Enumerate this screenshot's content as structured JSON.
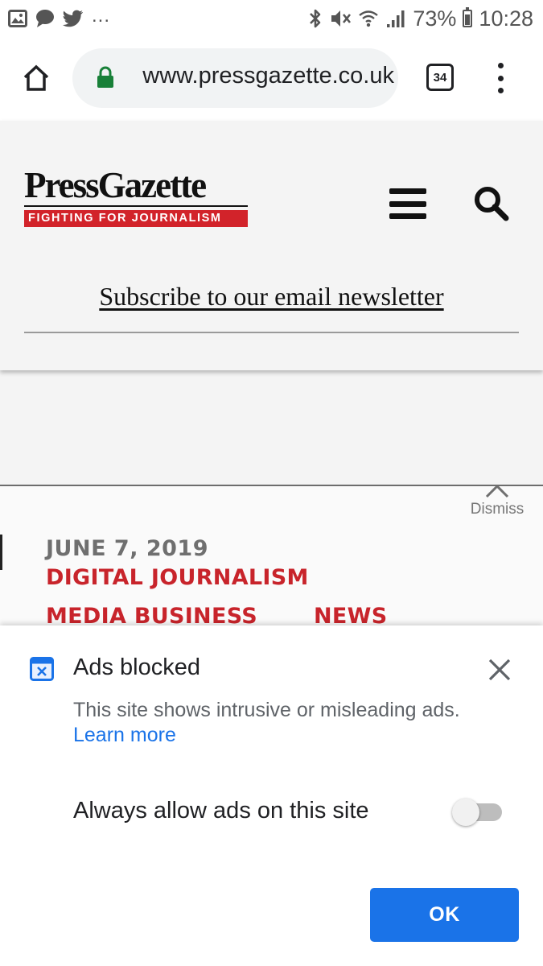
{
  "status_bar": {
    "notification_icons": [
      "image-icon",
      "chat-bubble-icon",
      "twitter-bird-icon"
    ],
    "overflow": "...",
    "system_icons": [
      "bluetooth-icon",
      "vibrate-mute-icon",
      "wifi-icon",
      "cell-signal-icon",
      "battery-icon"
    ],
    "battery_percent": "73%",
    "battery_level": 0.73,
    "time": "10:28"
  },
  "browser": {
    "url": "www.pressgazette.co.uk",
    "tab_count": "34",
    "secure": true,
    "icons": [
      "home-icon",
      "lock-icon",
      "tab-switcher-icon",
      "more-vert-icon"
    ]
  },
  "site_header": {
    "logo_word": "PressGazette",
    "logo_tagline": "FIGHTING FOR JOURNALISM",
    "subscribe_link": "Subscribe to our email newsletter",
    "icons": [
      "hamburger-menu-icon",
      "search-icon"
    ]
  },
  "ad_slot": {
    "dismiss_label": "Dismiss"
  },
  "article": {
    "date": "JUNE 7, 2019",
    "categories": [
      "DIGITAL JOURNALISM",
      "MEDIA BUSINESS",
      "NEWS"
    ],
    "category_color": "#c8242b"
  },
  "ads_sheet": {
    "title": "Ads blocked",
    "description": "This site shows intrusive or misleading ads.",
    "learn_more": "Learn more",
    "allow_label": "Always allow ads on this site",
    "allow_enabled": false,
    "ok_label": "OK",
    "accent_color": "#1a73e8",
    "icons": [
      "ads-blocked-icon",
      "close-icon"
    ]
  }
}
